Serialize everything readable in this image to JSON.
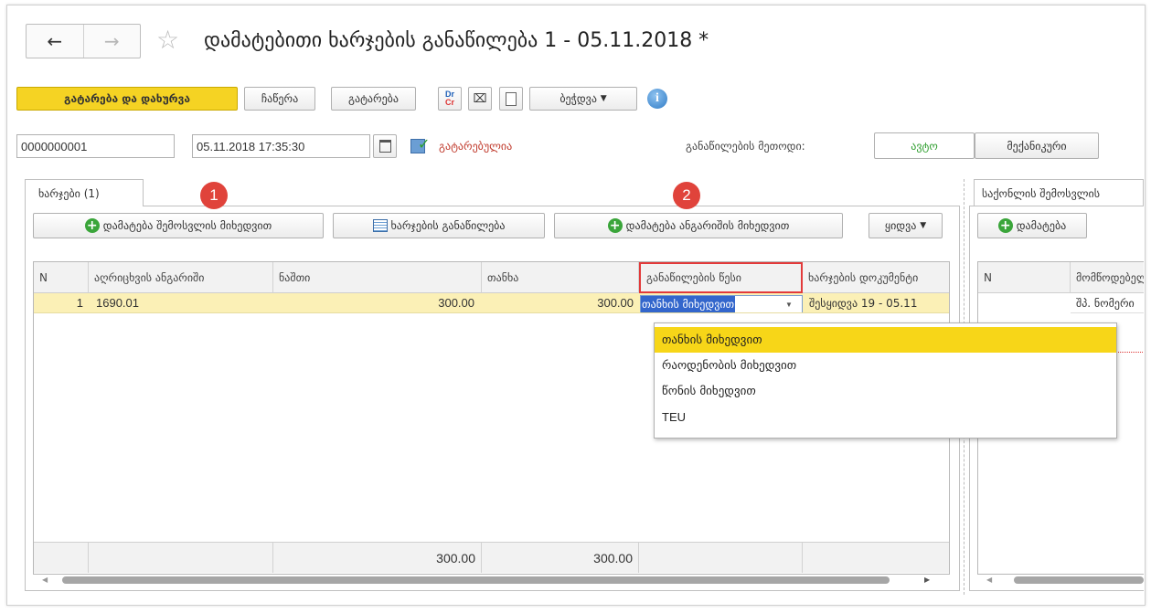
{
  "window": {
    "title": "დამატებითი ხარჯების განაწილება 1 - 05.11.2018 *"
  },
  "toolbar": {
    "post_close": "გატარება და დახურვა",
    "write": "ჩაწერა",
    "post": "გატარება",
    "drcr": "Dr Cr",
    "print": "ბეჭდვა"
  },
  "header": {
    "number": "0000000001",
    "date": "05.11.2018 17:35:30",
    "status": "გატარებულია",
    "method_label": "განაწილების მეთოდი:",
    "method_auto": "ავტო",
    "method_manual": "მექანიკური"
  },
  "left": {
    "tab": "ხარჯები (1)",
    "badge1": "1",
    "badge2": "2",
    "add_by_supplier": "დამატება შემოსვლის მიხედვით",
    "distribute": "ხარჯების განაწილება",
    "add_by_report": "დამატება ანგარიშის მიხედვით",
    "more": "ყიდვა",
    "columns": [
      "N",
      "აღრიცხვის ანგარიში",
      "ნაშთი",
      "თანხა",
      "განაწილების წესი",
      "ხარჯების დოკუმენტი"
    ],
    "row": {
      "n": "1",
      "account": "1690.01",
      "balance": "300.00",
      "amount": "300.00",
      "rule": "თანხის მიხედვით",
      "doc": "შესყიდვა 19 - 05.11"
    },
    "totals": {
      "balance": "300.00",
      "amount": "300.00"
    }
  },
  "dropdown": {
    "options": [
      "თანხის მიხედვით",
      "რაოდენობის მიხედვით",
      "წონის მიხედვით",
      "TEU"
    ],
    "selected": 0
  },
  "right": {
    "tab": "საქონლის შემოსვლის",
    "add": "დამატება",
    "columns": [
      "N",
      "მომწოდებელი"
    ],
    "row_value": "შპ. ნომერი"
  },
  "colors": {
    "accent": "#f5d323",
    "badge": "#e0433b",
    "status": "#c0392b",
    "auto": "#2e9e2e"
  }
}
